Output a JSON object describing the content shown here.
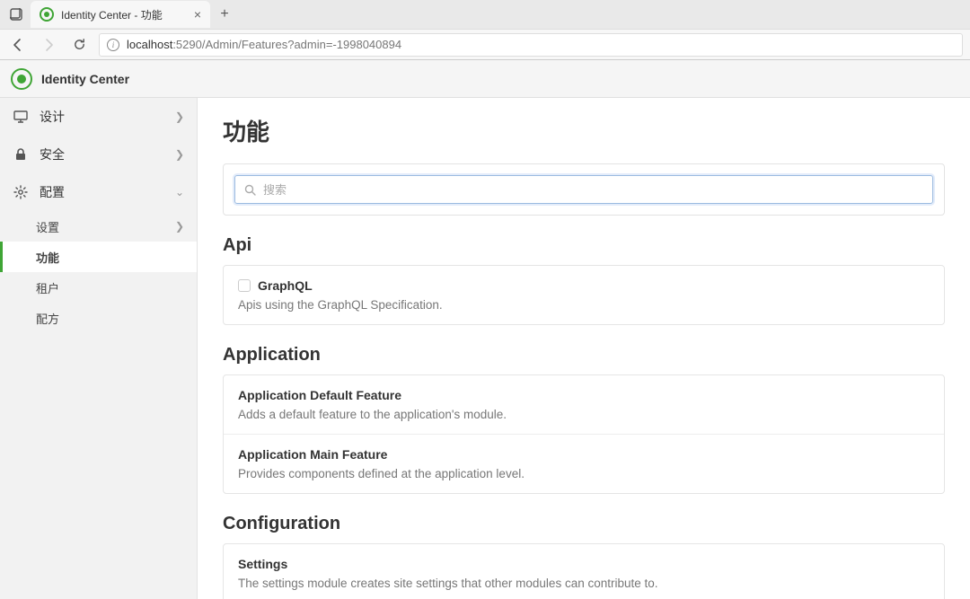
{
  "browser": {
    "tab_title": "Identity Center - 功能",
    "url_host": "localhost",
    "url_port_path": ":5290/Admin/Features?admin=-1998040894"
  },
  "header": {
    "brand": "Identity Center"
  },
  "sidebar": {
    "items": [
      {
        "label": "设计",
        "icon": "monitor",
        "expanded": false
      },
      {
        "label": "安全",
        "icon": "lock",
        "expanded": false
      },
      {
        "label": "配置",
        "icon": "gear",
        "expanded": true
      }
    ],
    "config_children": [
      {
        "label": "设置",
        "has_chevron": true,
        "active": false
      },
      {
        "label": "功能",
        "has_chevron": false,
        "active": true
      },
      {
        "label": "租户",
        "has_chevron": false,
        "active": false
      },
      {
        "label": "配方",
        "has_chevron": false,
        "active": false
      }
    ]
  },
  "main": {
    "title": "功能",
    "search_placeholder": "搜索",
    "sections": [
      {
        "title": "Api",
        "features": [
          {
            "name": "GraphQL",
            "desc": "Apis using the GraphQL Specification.",
            "checkbox": true
          }
        ]
      },
      {
        "title": "Application",
        "features": [
          {
            "name": "Application Default Feature",
            "desc": "Adds a default feature to the application's module.",
            "checkbox": false
          },
          {
            "name": "Application Main Feature",
            "desc": "Provides components defined at the application level.",
            "checkbox": false
          }
        ]
      },
      {
        "title": "Configuration",
        "features": [
          {
            "name": "Settings",
            "desc": "The settings module creates site settings that other modules can contribute to.",
            "checkbox": false
          }
        ]
      }
    ]
  }
}
